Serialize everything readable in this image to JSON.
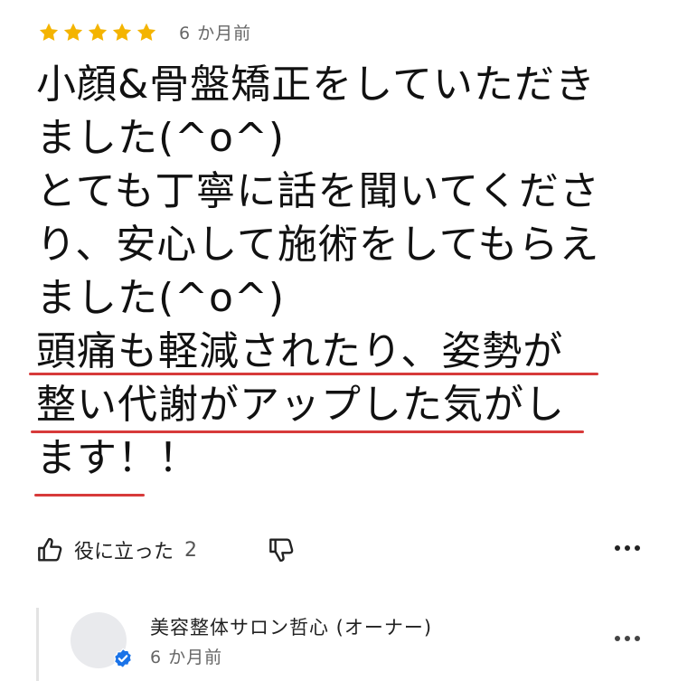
{
  "review": {
    "rating": 5,
    "date": "6 か月前",
    "text_lines": [
      "小顔&骨盤矯正をしていただき",
      "ました(^o^)",
      "とても丁寧に話を聞いてくださ",
      "り、安心して施術をしてもらえ",
      "ました(^o^)",
      "頭痛も軽減されたり、姿勢が",
      "整い代謝がアップした気がし",
      "ます！！"
    ]
  },
  "actions": {
    "like_label": "役に立った",
    "like_count": "2",
    "like_icon": "thumbs-up-icon",
    "dislike_icon": "thumbs-down-icon",
    "more_icon": "more-horizontal-icon"
  },
  "owner_response": {
    "name": "美容整体サロン哲心 (オーナー)",
    "date": "6 か月前",
    "verified_icon": "verified-check-icon"
  },
  "colors": {
    "star": "#f4b400",
    "underline": "#d73a3a",
    "verified": "#1a73e8"
  }
}
